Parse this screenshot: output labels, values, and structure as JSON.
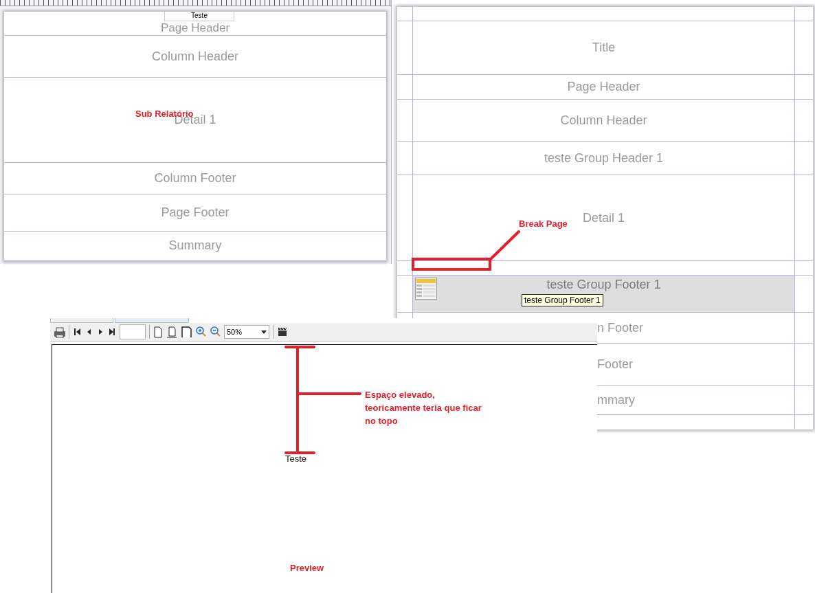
{
  "designer_left": {
    "field": "Teste",
    "bands": [
      {
        "label": "Page Header"
      },
      {
        "label": "Column Header"
      },
      {
        "label": "Detail 1"
      },
      {
        "label": "Column Footer"
      },
      {
        "label": "Page Footer"
      },
      {
        "label": "Summary"
      }
    ]
  },
  "designer_right": {
    "bands": [
      {
        "kind": "margin",
        "selected": false
      },
      {
        "kind": "band",
        "label": "Title",
        "selected": false
      },
      {
        "kind": "band",
        "label": "Page Header",
        "selected": false
      },
      {
        "kind": "band",
        "label": "Column Header",
        "selected": false
      },
      {
        "kind": "band",
        "label": "teste Group Header 1",
        "selected": false
      },
      {
        "kind": "band",
        "label": "Detail 1",
        "selected": false
      },
      {
        "kind": "band",
        "selected": false
      },
      {
        "kind": "band",
        "label": "teste Group Footer 1",
        "selected": true,
        "tooltip": "teste Group Footer 1"
      },
      {
        "kind": "cut",
        "label": "n Footer",
        "selected": false
      },
      {
        "kind": "cut",
        "label": "Footer",
        "selected": false
      },
      {
        "kind": "cut",
        "label": "mmary",
        "selected": false
      },
      {
        "kind": "margin",
        "selected": false
      }
    ]
  },
  "preview": {
    "zoom": "50%",
    "text": "Teste"
  },
  "annotations": {
    "sub_report": "Sub Relatório",
    "break_page": "Break Page",
    "raised_space": "Espaço elevado, teoricamente teria que ficar no topo",
    "preview": "Preview"
  }
}
